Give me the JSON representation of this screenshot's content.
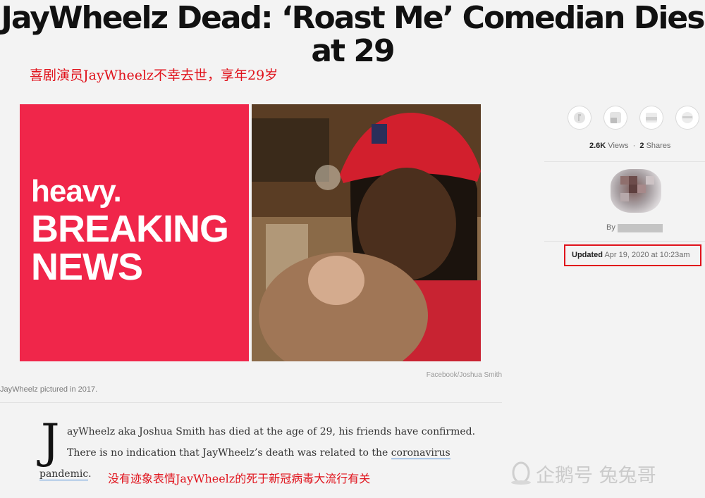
{
  "article": {
    "headline": "JayWheelz Dead: ‘Roast Me’ Comedian Dies at 29",
    "annotation_cn_title": "喜剧演员JayWheelz不幸去世，享年29岁",
    "hero_brand": "heavy.",
    "hero_label_line1": "BREAKING",
    "hero_label_line2": "NEWS",
    "photo_credit": "Facebook/Joshua Smith",
    "caption": "JayWheelz pictured in 2017.",
    "dropcap": "J",
    "body_line1": "ayWheelz aka Joshua Smith has died at the age of 29, his friends have confirmed.",
    "body_line2_prefix": "There is no indication that JayWheelz’s death was related to the ",
    "body_link1": "coronavirus",
    "body_link2": "pandemic",
    "body_line3_suffix": ".",
    "annotation_cn_note": "没有迹象表情JayWheelz的死于新冠病毒大流行有关"
  },
  "sidebar": {
    "views_count": "2.6K",
    "views_label": "Views",
    "separator": "·",
    "shares_count": "2",
    "shares_label": "Shares",
    "by_label": "By",
    "updated_label": "Updated",
    "updated_date": "Apr 19, 2020 at 10:23am",
    "share_icons": [
      "facebook-icon",
      "twitter-icon",
      "email-icon",
      "comment-icon"
    ]
  },
  "watermark": {
    "text": "企鹅号 兔兔哥"
  },
  "colors": {
    "brand_red": "#f0264a",
    "annotation_red": "#e0121b",
    "link_underline": "#4a8cd6"
  }
}
